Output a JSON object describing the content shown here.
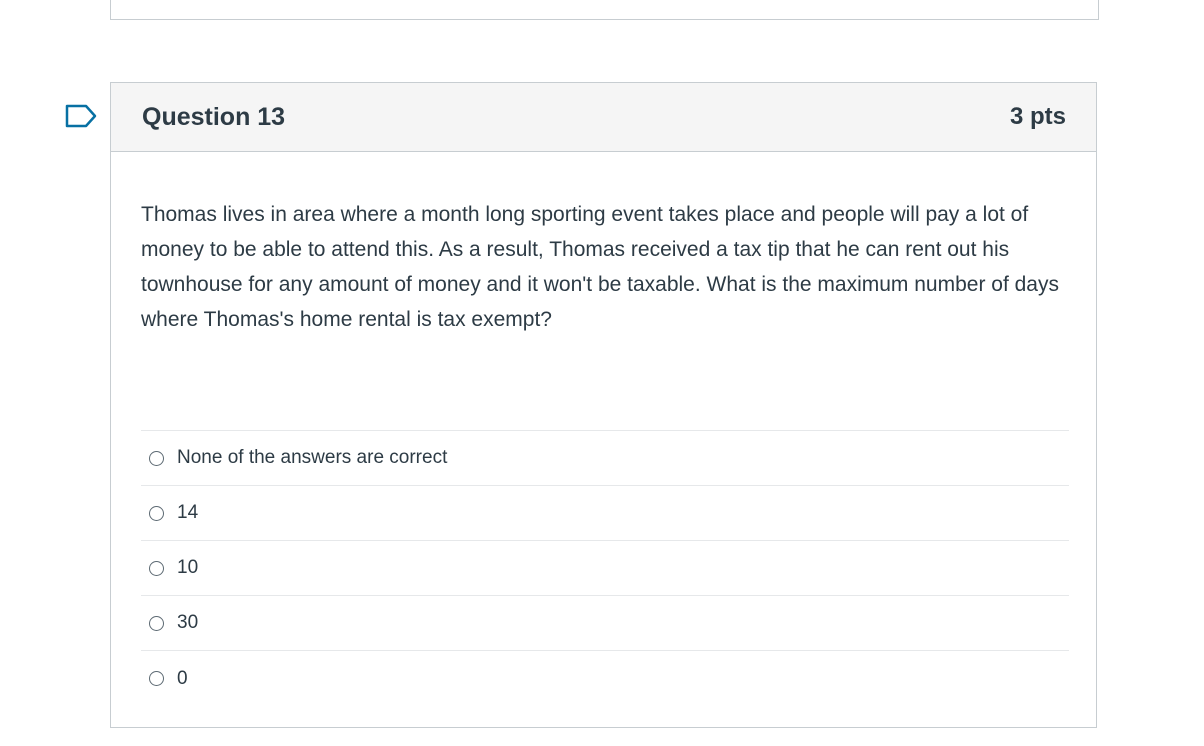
{
  "question": {
    "title": "Question 13",
    "points": "3 pts",
    "text": "Thomas lives in area where a month long sporting event takes place and people will pay a lot of money to be able to attend this. As a result, Thomas received a tax tip that he can rent out his townhouse for any amount of money and it won't be taxable. What is the maximum number of days where Thomas's home rental is tax exempt?",
    "answers": [
      {
        "label": "None of the answers are correct"
      },
      {
        "label": "14"
      },
      {
        "label": "10"
      },
      {
        "label": "30"
      },
      {
        "label": "0"
      }
    ]
  },
  "icons": {
    "flag": "bookmark-flag-icon",
    "radio": "radio-unchecked-icon"
  },
  "colors": {
    "header_bg": "#f5f5f5",
    "border": "#c7cdd1",
    "text": "#2d3b45",
    "flag": "#0770a3"
  }
}
